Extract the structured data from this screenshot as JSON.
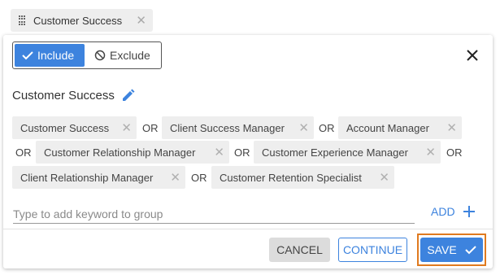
{
  "tab": {
    "label": "Customer Success"
  },
  "toggle": {
    "include_label": "Include",
    "exclude_label": "Exclude",
    "selected": "Include"
  },
  "group": {
    "title": "Customer Success",
    "keywords": [
      "Customer Success",
      "Client Success Manager",
      "Account Manager",
      "Customer Relationship Manager",
      "Customer Experience Manager",
      "Client Relationship Manager",
      "Customer Retention Specialist"
    ],
    "connector": "OR"
  },
  "input": {
    "placeholder": "Type to add keyword to group",
    "value": ""
  },
  "add_label": "ADD",
  "buttons": {
    "cancel": "CANCEL",
    "continue": "CONTINUE",
    "save": "SAVE"
  },
  "colors": {
    "accent": "#3d83de",
    "highlight": "#e07a1f",
    "chip": "#eeeeee"
  }
}
